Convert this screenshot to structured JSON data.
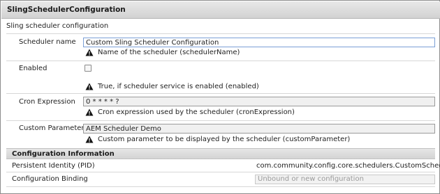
{
  "header": {
    "title": "SlingSchedulerConfiguration"
  },
  "description": "Sling scheduler configuration",
  "fields": [
    {
      "label": "Scheduler name",
      "value": "Custom Sling Scheduler Configuration",
      "hint": "Name of the scheduler (schedulerName)"
    },
    {
      "label": "Enabled",
      "checked": false,
      "hint": "True, if scheduler service is enabled (enabled)"
    },
    {
      "label": "Cron Expression",
      "value": "0 * * * * ?",
      "hint": "Cron expression used by the scheduler (cronExpression)"
    },
    {
      "label": "Custom Parameter",
      "value": "AEM Scheduler Demo",
      "hint": "Custom parameter to be displayed by the scheduler (customParameter)"
    }
  ],
  "config_info": {
    "title": "Configuration Information",
    "pid_label": "Persistent Identity (PID)",
    "pid_value": "com.community.config.core.schedulers.CustomScheduler",
    "binding_label": "Configuration Binding",
    "binding_value": "Unbound or new configuration"
  },
  "colors": {
    "warning": "#111111",
    "focus_border": "#7a9fd6"
  },
  "icons": {
    "hint": "warning-icon"
  }
}
